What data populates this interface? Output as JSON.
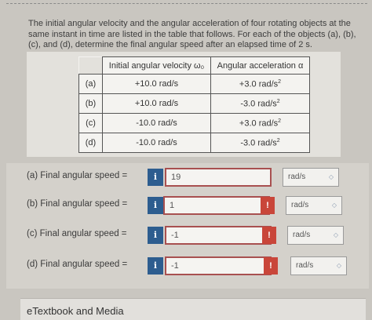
{
  "question_text": "The initial angular velocity and the angular acceleration of four rotating objects at the same instant in time are listed in the table that follows. For each of the objects (a), (b), (c), and (d), determine the final angular speed after an elapsed time of 2 s.",
  "table": {
    "headers": [
      "Initial angular velocity ω₀",
      "Angular acceleration α"
    ],
    "rows": [
      {
        "label": "(a)",
        "omega": "+10.0 rad/s",
        "alpha": "+3.0 rad/s",
        "exp": "2"
      },
      {
        "label": "(b)",
        "omega": "+10.0 rad/s",
        "alpha": "-3.0 rad/s",
        "exp": "2"
      },
      {
        "label": "(c)",
        "omega": "-10.0 rad/s",
        "alpha": "+3.0 rad/s",
        "exp": "2"
      },
      {
        "label": "(d)",
        "omega": "-10.0 rad/s",
        "alpha": "-3.0 rad/s",
        "exp": "2"
      }
    ]
  },
  "answers": [
    {
      "label": "(a)   Final angular speed =",
      "value": "19",
      "unit": "rad/s",
      "error": false
    },
    {
      "label": "(b)   Final angular speed =",
      "value": "1",
      "unit": "rad/s",
      "error": true
    },
    {
      "label": "(c)   Final angular speed =",
      "value": "-1",
      "unit": "rad/s",
      "error": true
    },
    {
      "label": "(d)   Final angular speed =",
      "value": "-1",
      "unit": "rad/s",
      "error": true
    }
  ],
  "info_icon": "i",
  "error_icon": "!",
  "chevron_icon": "◇",
  "footer": {
    "etextbook": "eTextbook and Media"
  },
  "colors": {
    "info": "#2d5d8f",
    "error": "#c9463a",
    "input_border_error": "#a85050"
  }
}
